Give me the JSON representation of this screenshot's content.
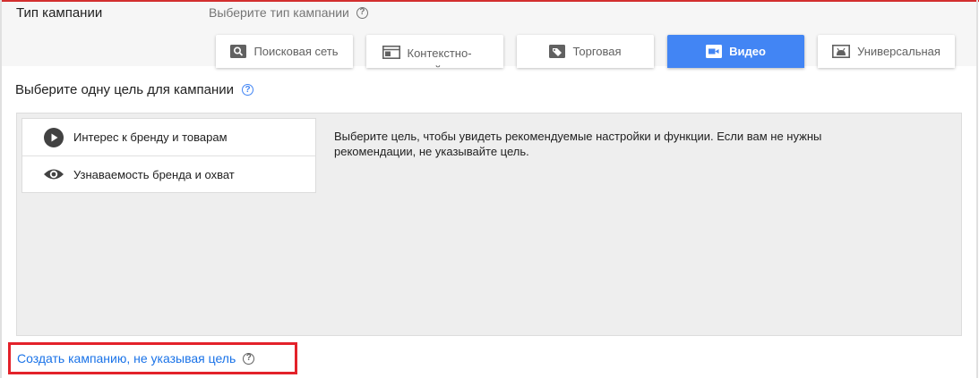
{
  "campaign_type": {
    "label": "Тип кампании",
    "hint": "Выберите тип кампании",
    "tabs": [
      {
        "label": "Поисковая сеть",
        "icon": "search-icon",
        "active": false
      },
      {
        "label": "Контекстно-медийная",
        "icon": "display-icon",
        "active": false
      },
      {
        "label": "Торговая",
        "icon": "shopping-tag-icon",
        "active": false
      },
      {
        "label": "Видео",
        "icon": "video-camera-icon",
        "active": true
      },
      {
        "label": "Универсальная",
        "icon": "android-app-icon",
        "active": false
      }
    ]
  },
  "goal_section": {
    "title": "Выберите одну цель для кампании",
    "goals": [
      {
        "label": "Интерес к бренду и товарам",
        "icon": "play-circle-icon"
      },
      {
        "label": "Узнаваемость бренда и охват",
        "icon": "eye-icon"
      }
    ],
    "description": "Выберите цель, чтобы увидеть рекомендуемые настройки и функции. Если вам не нужны рекомендации, не указывайте цель."
  },
  "no_goal_link": "Создать кампанию, не указывая цель",
  "help_glyph": "?",
  "colors": {
    "accent_blue": "#4285f4",
    "link_blue": "#1a73e8",
    "highlight_red": "#e3222a",
    "panel_grey": "#eeeeee"
  }
}
